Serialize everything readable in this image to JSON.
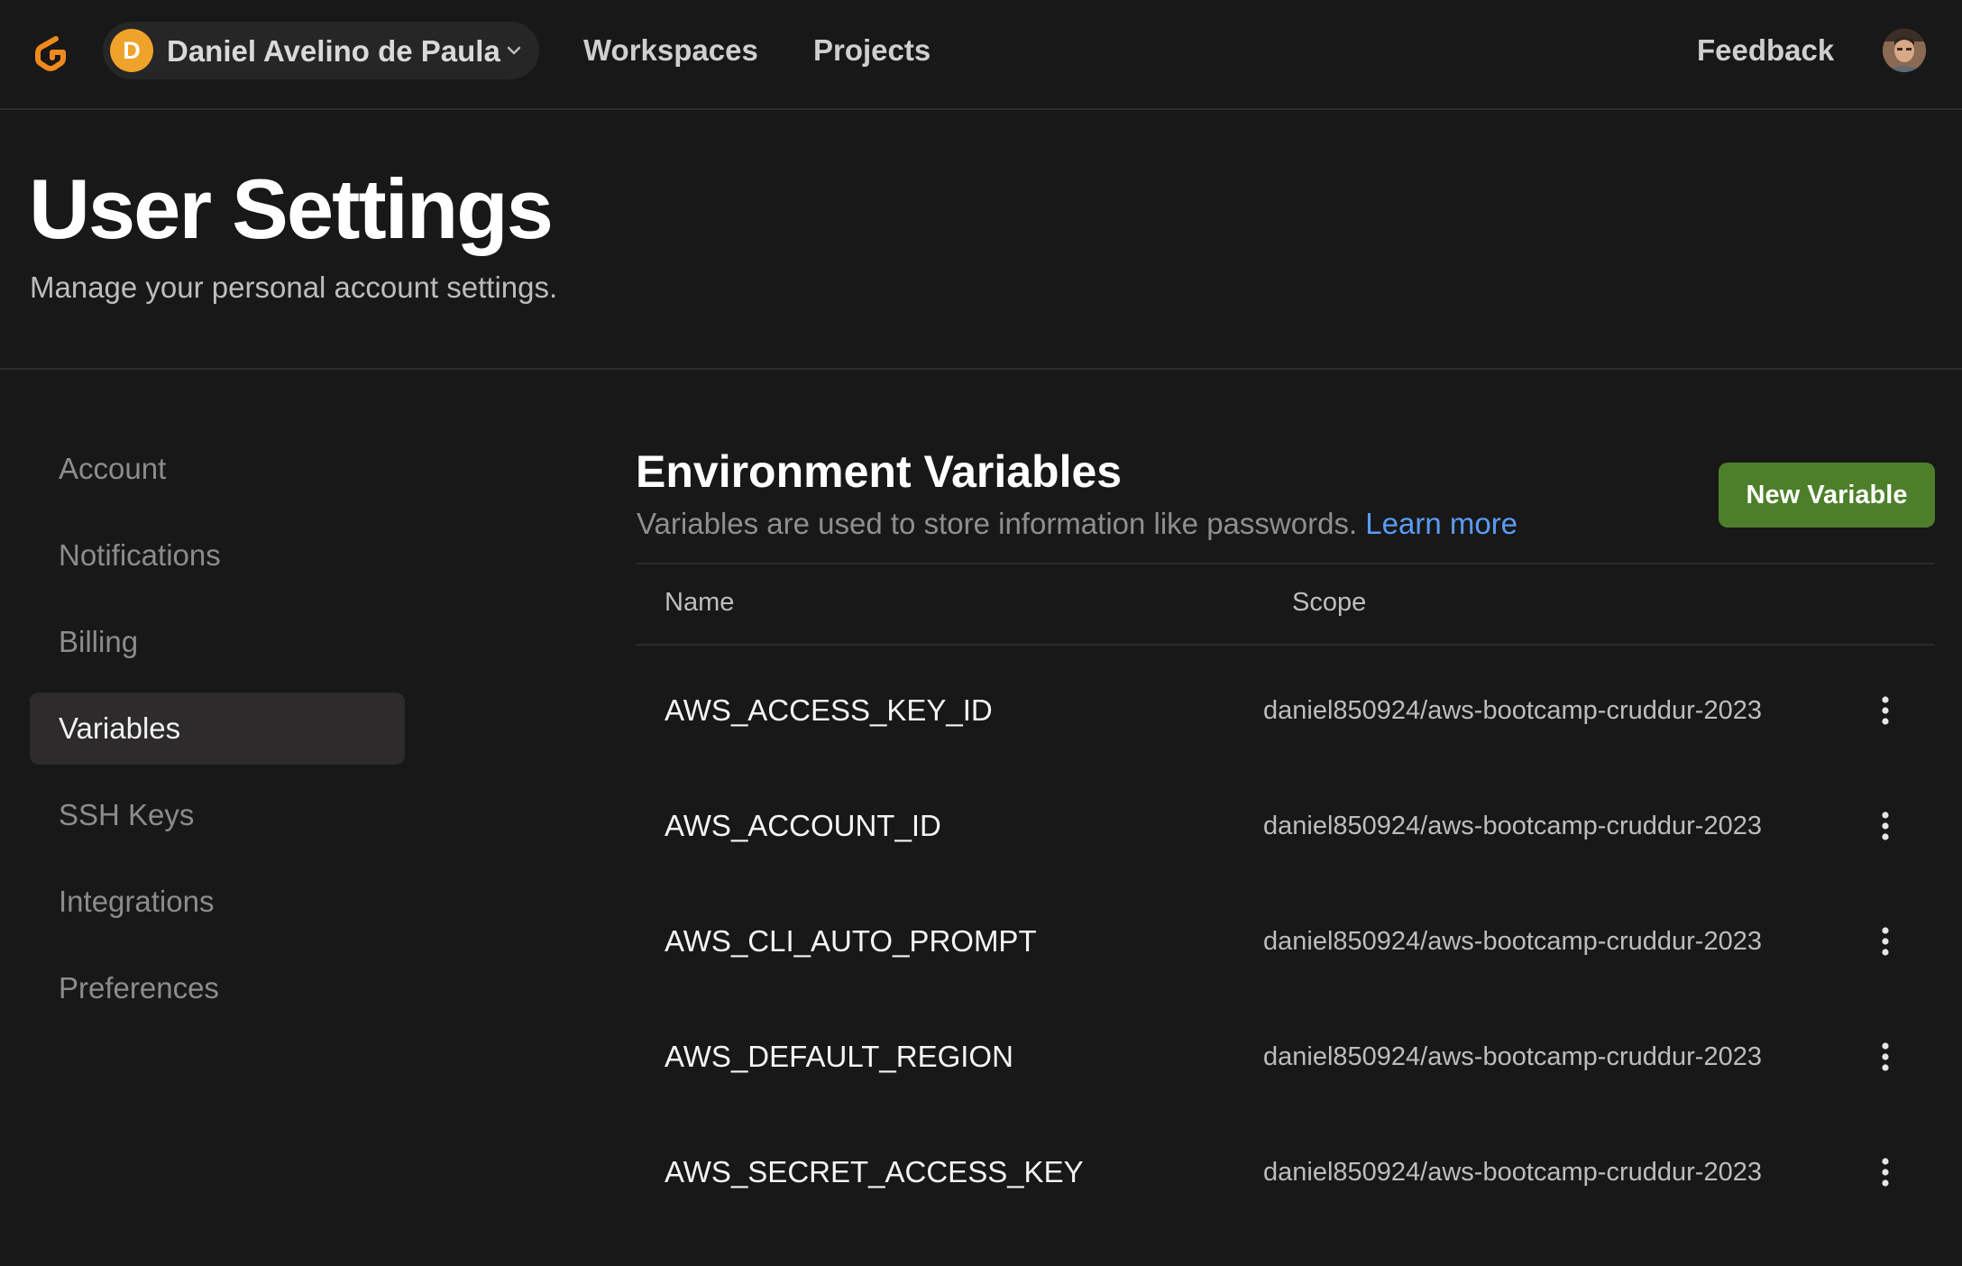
{
  "topbar": {
    "logo_icon": "gitpod-logo-icon",
    "account_initial": "D",
    "account_name": "Daniel Avelino de Paula",
    "nav": [
      "Workspaces",
      "Projects"
    ],
    "feedback_label": "Feedback",
    "user_photo_icon": "user-avatar-photo"
  },
  "header": {
    "title": "User Settings",
    "subtitle": "Manage your personal account settings."
  },
  "sidebar": {
    "items": [
      {
        "label": "Account",
        "active": false
      },
      {
        "label": "Notifications",
        "active": false
      },
      {
        "label": "Billing",
        "active": false
      },
      {
        "label": "Variables",
        "active": true
      },
      {
        "label": "SSH Keys",
        "active": false
      },
      {
        "label": "Integrations",
        "active": false
      },
      {
        "label": "Preferences",
        "active": false
      }
    ]
  },
  "main": {
    "title": "Environment Variables",
    "description": "Variables are used to store information like passwords.",
    "learn_more": "Learn more",
    "new_button": "New Variable",
    "columns": [
      "Name",
      "Scope"
    ],
    "rows": [
      {
        "name": "AWS_ACCESS_KEY_ID",
        "scope": "daniel850924/aws-bootcamp-cruddur-2023"
      },
      {
        "name": "AWS_ACCOUNT_ID",
        "scope": "daniel850924/aws-bootcamp-cruddur-2023"
      },
      {
        "name": "AWS_CLI_AUTO_PROMPT",
        "scope": "daniel850924/aws-bootcamp-cruddur-2023"
      },
      {
        "name": "AWS_DEFAULT_REGION",
        "scope": "daniel850924/aws-bootcamp-cruddur-2023"
      },
      {
        "name": "AWS_SECRET_ACCESS_KEY",
        "scope": "daniel850924/aws-bootcamp-cruddur-2023"
      }
    ]
  },
  "colors": {
    "background": "#181818",
    "accent_orange": "#f0a32a",
    "button_green": "#4d7f2a",
    "link_blue": "#5b9cf5"
  }
}
